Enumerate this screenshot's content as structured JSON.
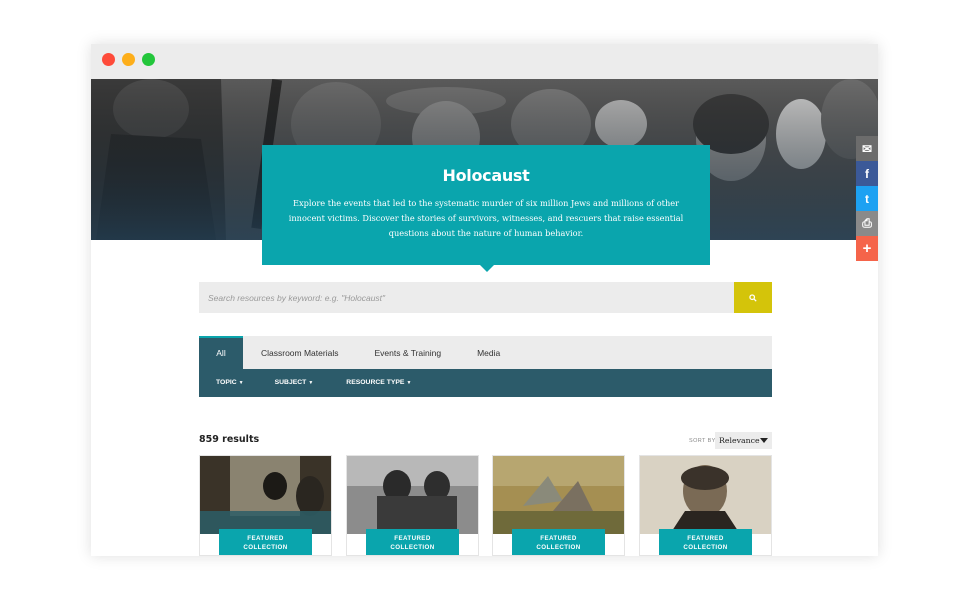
{
  "hero": {
    "title": "Holocaust",
    "description": "Explore the events that led to the systematic murder of six million Jews and millions of other innocent victims. Discover the stories of survivors, witnesses, and rescuers that raise essential questions about the nature of human behavior."
  },
  "share": [
    {
      "name": "email-icon",
      "glyph": "✉"
    },
    {
      "name": "facebook-icon",
      "glyph": "f"
    },
    {
      "name": "twitter-icon",
      "glyph": "t"
    },
    {
      "name": "print-icon",
      "glyph": "⎙"
    },
    {
      "name": "more-icon",
      "glyph": "+"
    }
  ],
  "search": {
    "placeholder": "Search resources by keyword: e.g. \"Holocaust\"",
    "icon": "search-icon"
  },
  "tabs": [
    "All",
    "Classroom Materials",
    "Events & Training",
    "Media"
  ],
  "active_tab": "All",
  "filters": [
    "TOPIC",
    "SUBJECT",
    "RESOURCE TYPE"
  ],
  "results": {
    "count_label": "859 results",
    "sort_label": "SORT BY",
    "sort_value": "Relevance"
  },
  "cards": [
    {
      "badge_line1": "FEATURED",
      "badge_line2": "COLLECTION"
    },
    {
      "badge_line1": "FEATURED",
      "badge_line2": "COLLECTION"
    },
    {
      "badge_line1": "FEATURED",
      "badge_line2": "COLLECTION"
    },
    {
      "badge_line1": "FEATURED",
      "badge_line2": "COLLECTION"
    }
  ],
  "colors": {
    "teal": "#0aa5ad",
    "dark_teal": "#2c5b6a",
    "search_button": "#d4c40a"
  }
}
